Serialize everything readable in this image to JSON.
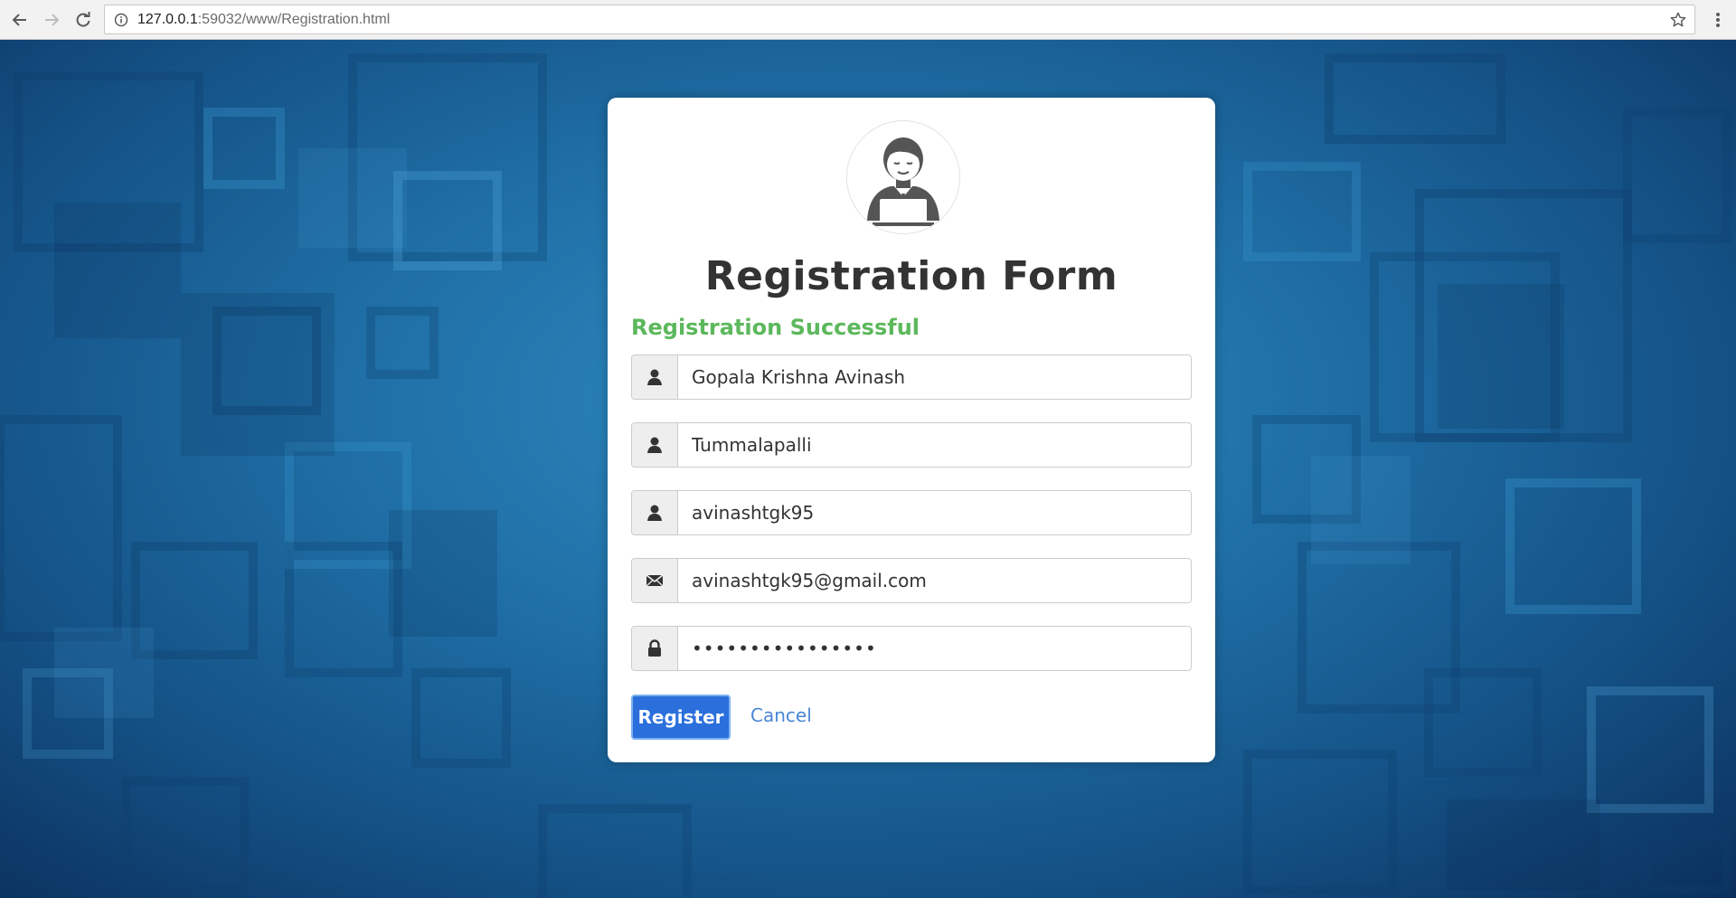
{
  "browser": {
    "url_host": "127.0.0.1",
    "url_rest": ":59032/www/Registration.html"
  },
  "form": {
    "title": "Registration Form",
    "status_message": "Registration Successful",
    "fields": [
      {
        "value": "Gopala Krishna Avinash",
        "icon": "user-icon"
      },
      {
        "value": "Tummalapalli",
        "icon": "user-icon"
      },
      {
        "value": "avinashtgk95",
        "icon": "user-icon"
      },
      {
        "value": "avinashtgk95@gmail.com",
        "icon": "envelope-icon"
      },
      {
        "value": "••••••••••••••••",
        "icon": "lock-icon"
      }
    ],
    "register_label": "Register",
    "cancel_label": "Cancel"
  },
  "colors": {
    "status_green": "#5cb85c",
    "button_blue": "#2a6fdc",
    "link_blue": "#4a86d6"
  }
}
